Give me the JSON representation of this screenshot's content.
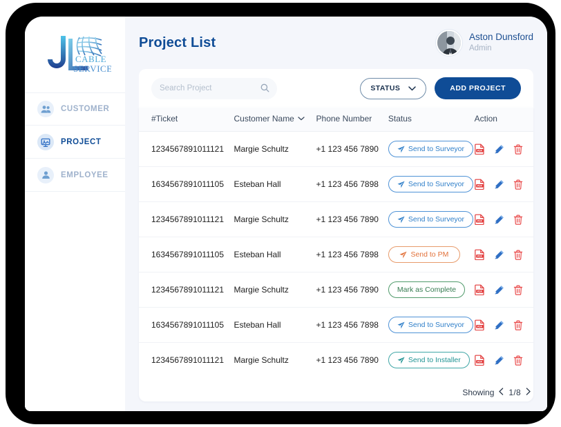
{
  "brand": {
    "logo_letters": "JL",
    "logo_line1": "CABLE",
    "logo_line2": "SERVICES"
  },
  "sidebar": {
    "items": [
      {
        "label": "CUSTOMER",
        "icon": "customers-icon",
        "active": false
      },
      {
        "label": "PROJECT",
        "icon": "project-board-icon",
        "active": true
      },
      {
        "label": "EMPLOYEE",
        "icon": "employee-icon",
        "active": false
      }
    ]
  },
  "header": {
    "title": "Project List",
    "user": {
      "name": "Aston Dunsford",
      "role": "Admin",
      "avatar_icon": "user-avatar-photo"
    }
  },
  "toolbar": {
    "search_placeholder": "Search Project",
    "search_value": "",
    "search_icon": "search-icon",
    "status_label": "STATUS",
    "status_icon": "chevron-down-icon",
    "add_project_label": "ADD PROJECT"
  },
  "table": {
    "columns": [
      {
        "label": "#Ticket",
        "sortable": false
      },
      {
        "label": "Customer Name",
        "sortable": true,
        "icon": "chevron-down-icon"
      },
      {
        "label": "Phone Number",
        "sortable": false
      },
      {
        "label": "Status",
        "sortable": false
      },
      {
        "label": "Action",
        "sortable": false
      }
    ],
    "rows": [
      {
        "ticket": "1234567891011121",
        "customer": "Margie Schultz",
        "phone": "+1 123 456 7890",
        "status": {
          "label": "Send to Surveyor",
          "kind": "surveyor",
          "icon": "paper-plane-icon",
          "color": "#2f7fc9"
        }
      },
      {
        "ticket": "1634567891011105",
        "customer": "Esteban Hall",
        "phone": "+1 123 456 7898",
        "status": {
          "label": "Send to Surveyor",
          "kind": "surveyor",
          "icon": "paper-plane-icon",
          "color": "#2f7fc9"
        }
      },
      {
        "ticket": "1234567891011121",
        "customer": "Margie Schultz",
        "phone": "+1 123 456 7890",
        "status": {
          "label": "Send to Surveyor",
          "kind": "surveyor",
          "icon": "paper-plane-icon",
          "color": "#2f7fc9"
        }
      },
      {
        "ticket": "1634567891011105",
        "customer": "Esteban Hall",
        "phone": "+1 123 456 7898",
        "status": {
          "label": "Send to PM",
          "kind": "pm",
          "icon": "paper-plane-icon",
          "color": "#e2713a"
        }
      },
      {
        "ticket": "1234567891011121",
        "customer": "Margie Schultz",
        "phone": "+1 123 456 7890",
        "status": {
          "label": "Mark as Complete",
          "kind": "complete",
          "icon": "none",
          "color": "#357c50"
        }
      },
      {
        "ticket": "1634567891011105",
        "customer": "Esteban Hall",
        "phone": "+1 123 456 7898",
        "status": {
          "label": "Send to Surveyor",
          "kind": "surveyor",
          "icon": "paper-plane-icon",
          "color": "#2f7fc9"
        }
      },
      {
        "ticket": "1234567891011121",
        "customer": "Margie Schultz",
        "phone": "+1 123 456 7890",
        "status": {
          "label": "Send to Installer",
          "kind": "installer",
          "icon": "paper-plane-icon",
          "color": "#1f9393"
        }
      }
    ],
    "row_actions": [
      {
        "icon": "pdf-file-icon",
        "color": "#e23b3b"
      },
      {
        "icon": "edit-pencil-icon",
        "color": "#2f6fc4"
      },
      {
        "icon": "delete-trash-icon",
        "color": "#e94a4a"
      }
    ]
  },
  "pagination": {
    "showing_label": "Showing",
    "prev_icon": "chevron-left-icon",
    "page_text": "1/8",
    "next_icon": "chevron-right-icon"
  },
  "colors": {
    "accent": "#0f4c96",
    "page_bg": "#f4f6fb",
    "card": "#ffffff",
    "muted": "#9fb2cc"
  }
}
